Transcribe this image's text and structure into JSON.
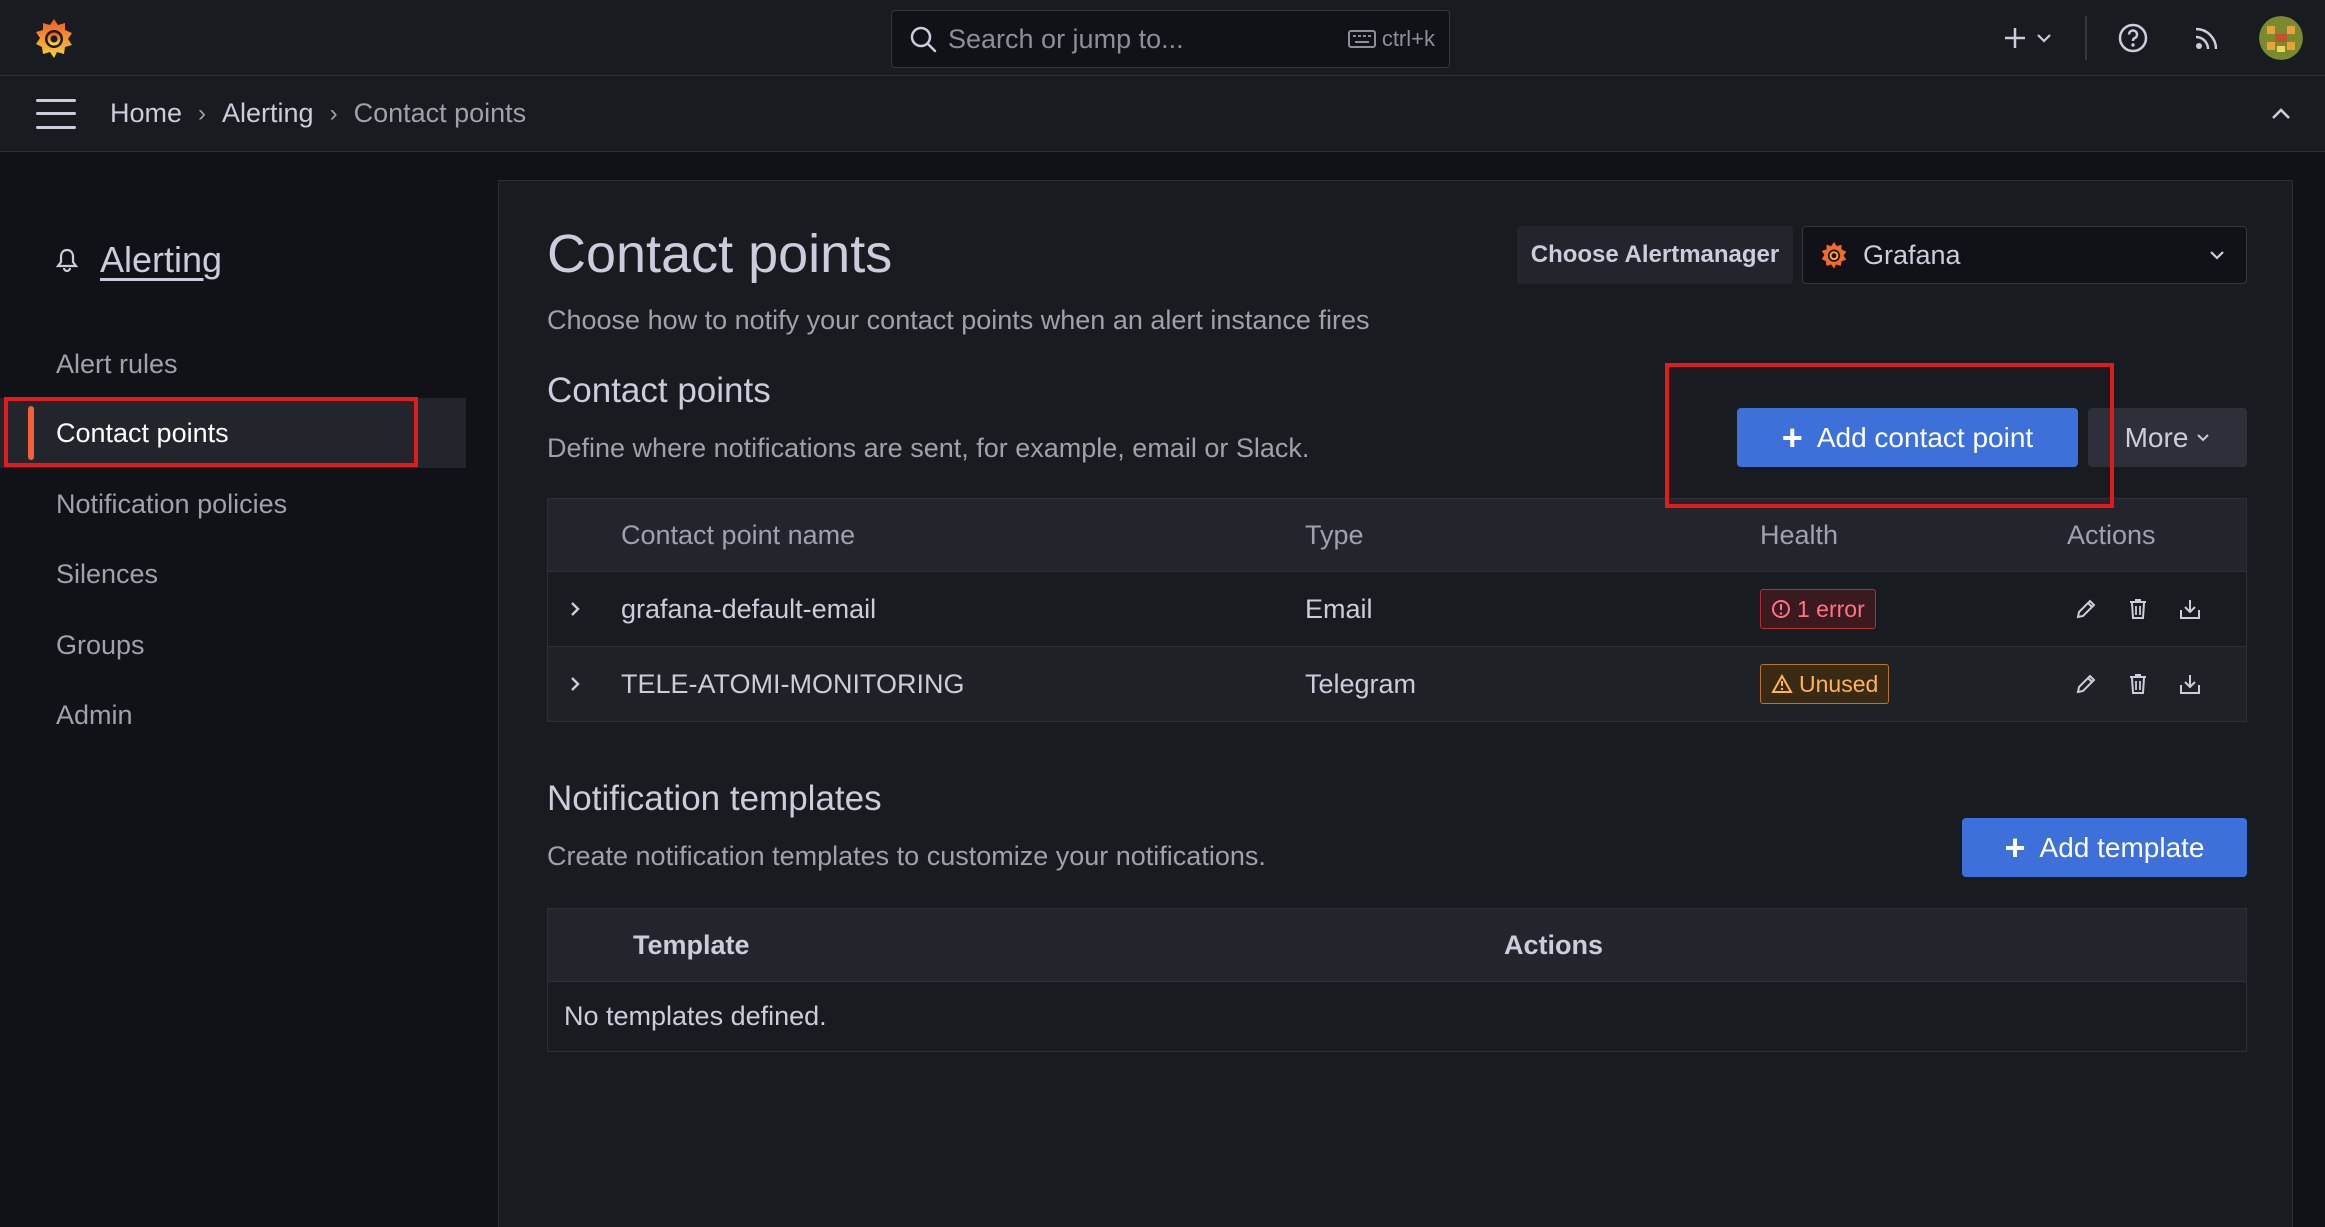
{
  "topbar": {
    "search_placeholder": "Search or jump to...",
    "shortcut": "ctrl+k"
  },
  "breadcrumb": [
    "Home",
    "Alerting",
    "Contact points"
  ],
  "sidebar": {
    "title": "Alerting",
    "items": [
      {
        "label": "Alert rules"
      },
      {
        "label": "Contact points"
      },
      {
        "label": "Notification policies"
      },
      {
        "label": "Silences"
      },
      {
        "label": "Groups"
      },
      {
        "label": "Admin"
      }
    ]
  },
  "main": {
    "title": "Contact points",
    "subtitle": "Choose how to notify your contact points when an alert instance fires",
    "alertmanager_label": "Choose Alertmanager",
    "alertmanager_value": "Grafana",
    "contact_section": {
      "title": "Contact points",
      "subtitle": "Define where notifications are sent, for example, email or Slack.",
      "add_button": "Add contact point",
      "more_button": "More",
      "columns": [
        "Contact point name",
        "Type",
        "Health",
        "Actions"
      ],
      "rows": [
        {
          "name": "grafana-default-email",
          "type": "Email",
          "health": "1 error"
        },
        {
          "name": "TELE-ATOMI-MONITORING",
          "type": "Telegram",
          "health": "Unused"
        }
      ]
    },
    "templates_section": {
      "title": "Notification templates",
      "subtitle": "Create notification templates to customize your notifications.",
      "add_button": "Add template",
      "columns": [
        "Template",
        "Actions"
      ],
      "empty_text": "No templates defined."
    }
  },
  "colors": {
    "accent": "#3d71d9",
    "highlight_box": "#e01b1b",
    "active_indicator": "#f55f3e"
  }
}
